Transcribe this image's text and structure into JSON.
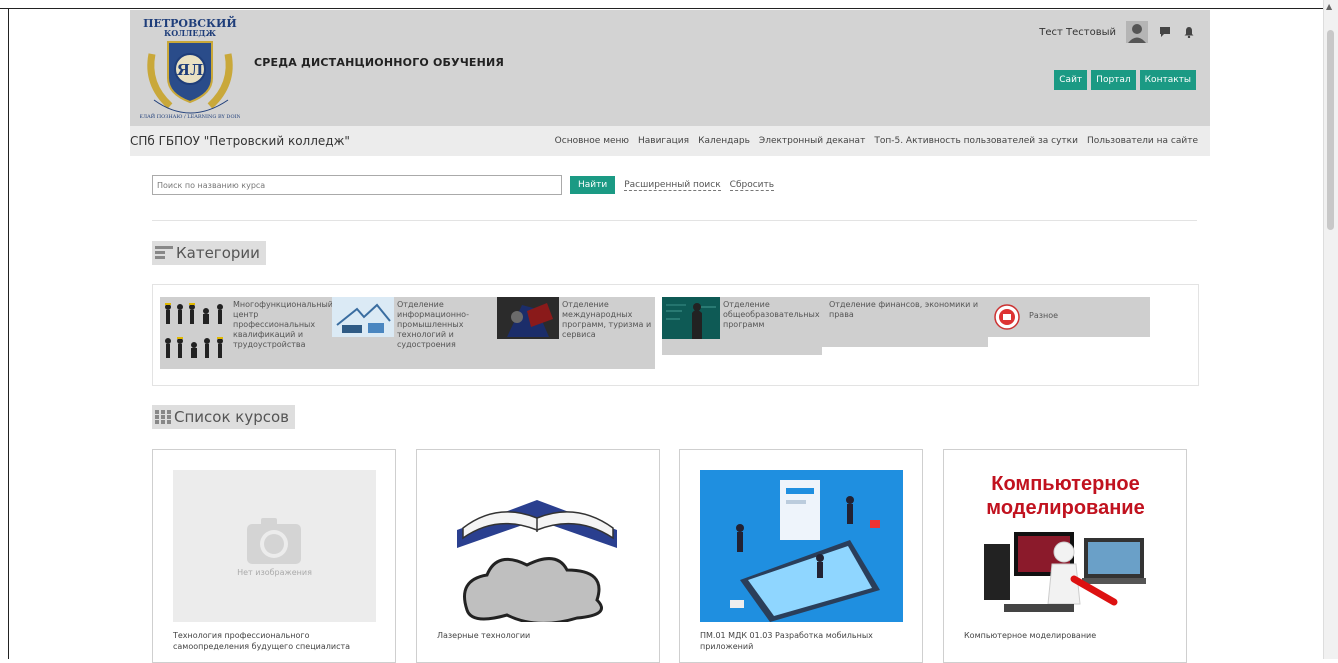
{
  "header": {
    "logo_top": "ПЕТРОВСКИЙ",
    "logo_sub": "КОЛЛЕДЖ",
    "logo_letters": "ЯЛ",
    "logo_motto": "ДЕЛАЙ ПОЗНАЮ / LEARNING BY DOING",
    "site_title": "СРЕДА ДИСТАНЦИОННОГО ОБУЧЕНИЯ",
    "user_name": "Тест Тестовый",
    "buttons": [
      "Сайт",
      "Портал",
      "Контакты"
    ]
  },
  "navbar": {
    "brand": "СПб ГБПОУ \"Петровский колледж\"",
    "links": [
      "Основное меню",
      "Навигация",
      "Календарь",
      "Электронный деканат",
      "Топ-5. Активность пользователей за сутки",
      "Пользователи на сайте"
    ]
  },
  "search": {
    "placeholder": "Поиск по названию курса",
    "button": "Найти",
    "advanced": "Расширенный поиск",
    "reset": "Сбросить"
  },
  "categories": {
    "title": "Категории",
    "items": [
      "Многофункциональный центр профессиональных квалификаций и трудоустройства",
      "Отделение информационно-промышленных технологий и судостроения",
      "Отделение международных программ, туризма и сервиса",
      "Отделение общеобразовательных программ",
      "Отделение финансов, экономики и права",
      "Разное"
    ]
  },
  "courses": {
    "title": "Список курсов",
    "no_image": "Нет изображения",
    "card4_banner": "Компьютерное моделирование",
    "items": [
      "Технология профессионального самоопределения будущего специалиста",
      "Лазерные технологии",
      "ПМ.01 МДК 01.03 Разработка мобильных приложений",
      "Компьютерное моделирование"
    ]
  },
  "colors": {
    "accent": "#1b9a84",
    "header_bg": "#d3d3d3",
    "navbar_bg": "#ececec",
    "category_bg": "#cfcfcf"
  }
}
